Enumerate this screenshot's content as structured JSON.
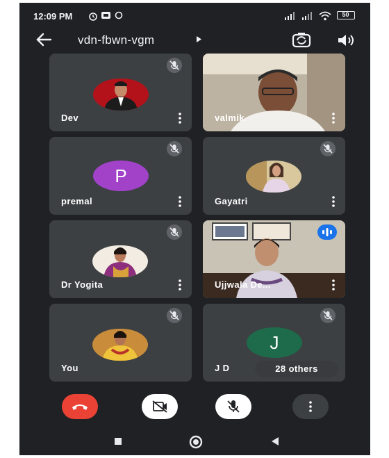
{
  "status_bar": {
    "time": "12:09 PM",
    "battery": "50"
  },
  "header": {
    "meeting_code": "vdn-fbwn-vgm"
  },
  "participants": [
    {
      "name": "Dev",
      "avatar": "photo-man-suit",
      "muted": true
    },
    {
      "name": "valmik",
      "avatar": "video-feed",
      "muted": false
    },
    {
      "name": "premal",
      "avatar": "letter",
      "letter": "P",
      "avatar_color": "#a142c9",
      "muted": true
    },
    {
      "name": "Gayatri",
      "avatar": "photo-woman",
      "muted": true
    },
    {
      "name": "Dr Yogita",
      "avatar": "photo-woman-saree",
      "muted": true
    },
    {
      "name": "Ujjwala De...",
      "avatar": "video-feed",
      "muted": false,
      "speaking": true
    },
    {
      "name": "You",
      "avatar": "photo-woman-yellow",
      "muted": true
    },
    {
      "name": "J D",
      "avatar": "letter",
      "letter": "J",
      "avatar_color": "#1e6b4b",
      "muted": true
    }
  ],
  "others_chip": "28 others",
  "colors": {
    "background": "#202124",
    "tile": "#3c4043",
    "end_call": "#ea4335",
    "speaking_indicator": "#1a73e8"
  },
  "icons": {
    "back": "arrow-left-icon",
    "switch_camera": "switch-camera-icon",
    "speaker": "speaker-icon",
    "mic_off": "mic-off-icon",
    "more": "more-vert-icon",
    "end_call": "phone-end-icon",
    "camera_off": "camera-off-icon"
  }
}
